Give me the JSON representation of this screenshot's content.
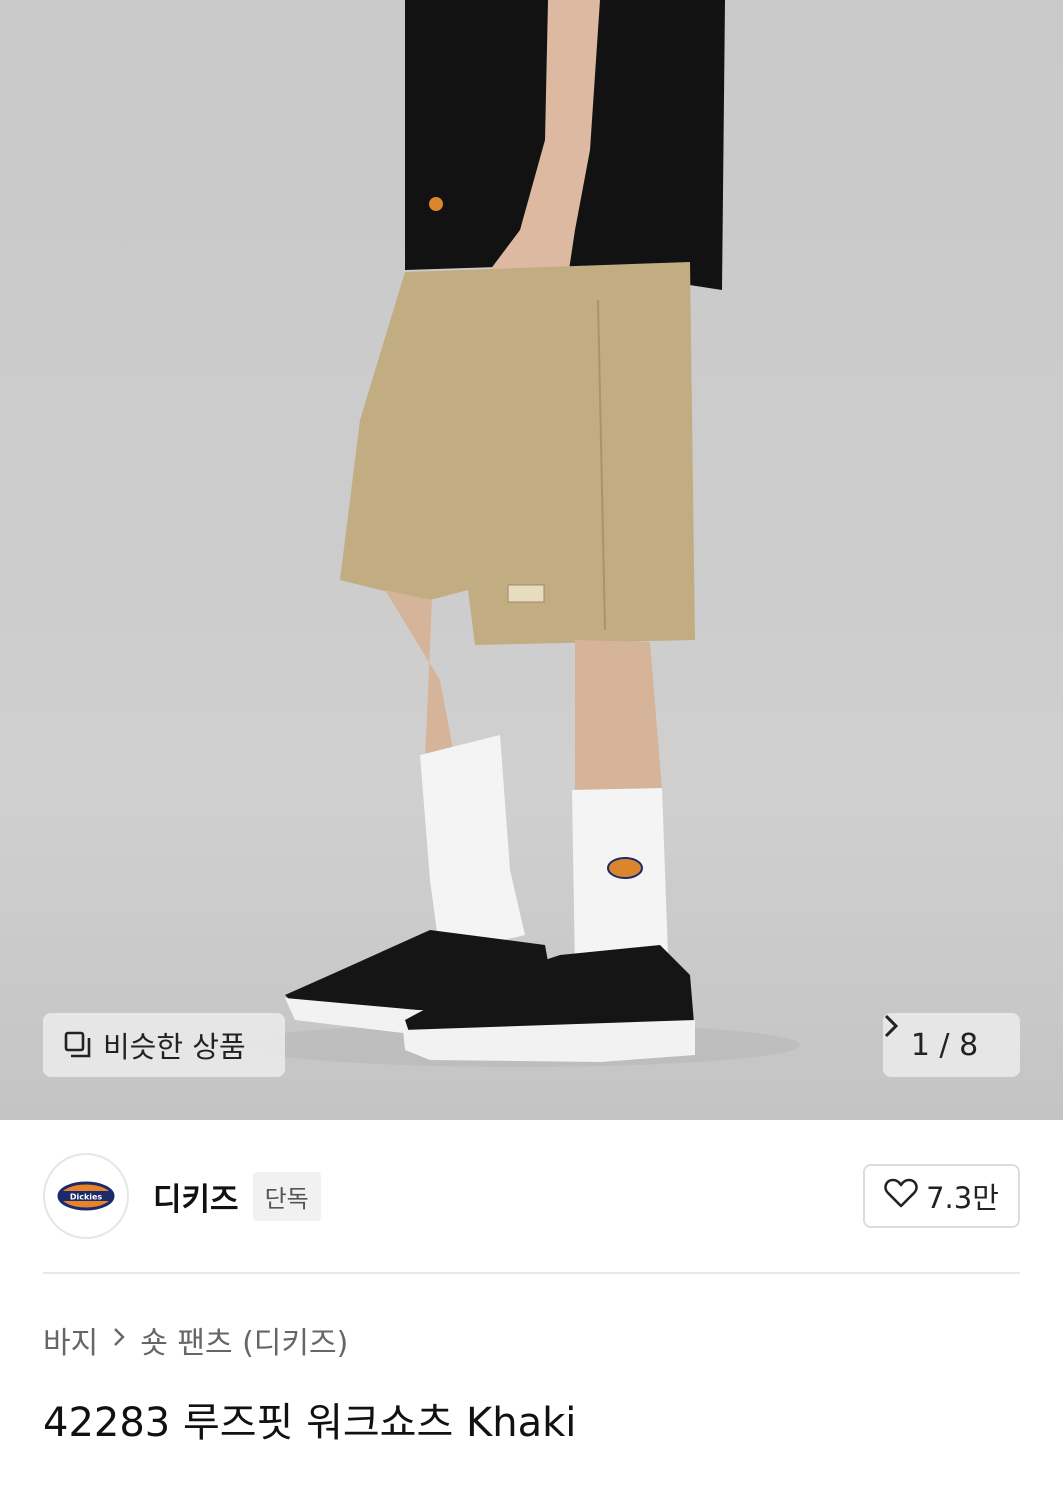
{
  "gallery": {
    "similar_label": "비슷한 상품",
    "page_indicator": "1 / 8",
    "next_icon": "chevron-right-icon"
  },
  "brand": {
    "name": "디키즈",
    "badge": "단독",
    "logo_text": "Dickies",
    "like_count": "7.3만"
  },
  "breadcrumb": {
    "category": "바지",
    "subcategory": "숏 팬츠 (디키즈)"
  },
  "product": {
    "title": "42283 루즈핏 워크쇼츠 Khaki"
  },
  "colors": {
    "background": "#ffffff",
    "photo_bg": "#cbcbcb",
    "shorts": "#c2ad82",
    "shirt": "#111111",
    "divider": "#e8e8e8"
  }
}
